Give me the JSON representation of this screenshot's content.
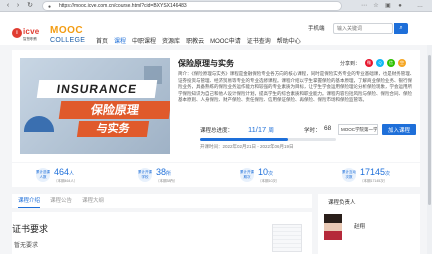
{
  "browser": {
    "url": "https://mooc.icve.com.cn/course.html?cid=BXYSX146483",
    "back_icon": "arrow-left-icon",
    "reload_icon": "reload-icon"
  },
  "header": {
    "logo_icve_text": "icve",
    "logo_icve_sub": "智慧职教",
    "logo_mooc_top": "MOOC",
    "logo_mooc_bottom": "COLLEGE",
    "nav": [
      "首页",
      "课程",
      "中职课程",
      "资源库",
      "职教云",
      "MOOC申请",
      "证书查询",
      "帮助中心"
    ],
    "active_nav": "课程",
    "search_label": "手机端",
    "search_placeholder": "输入关键词",
    "search_icon": "search-icon"
  },
  "course": {
    "title": "保险原理与实务",
    "cover_text_en": "INSURANCE",
    "cover_text_cn1": "保险原理",
    "cover_text_cn2": "与实务",
    "share_label": "分享到：",
    "intro": "简介：《保险原理与实务》课程是金融保险专业各方向的核心课程，同时是保险实务专业的专业基础课，也是财务管理、证券投资与管理、经济贸易等专业的专业选修课程。课程介绍以学生掌握保险的基本原理，了解商业保险业务、银行保险业务，具备熟练的保险业务运作能力和较强的专业素质为目标，让学生学会运用保险理论分析保险现象，学会运用所学保险知识为自己和他人设计保险计划，提高学生的综合素质和职业能力。课程内容包括风险与保险、保险合同、保险基本原则、人身保险、财产保险、责任保险、信用保证保险、再保险、保险市场和保险监管等。",
    "progress_label": "课程总进度：",
    "progress_value": "11/17",
    "progress_unit": "周",
    "progress_fraction": 0.647,
    "credit_label": "学时：",
    "credit_value": "68",
    "dates": "开课时间：2022年02月21日 - 2022年06月19日",
    "mooc_select": "MOOC学院第一学期",
    "join_button": "加入课程"
  },
  "stats": [
    {
      "icon": "students-icon",
      "label": "累计选课人数",
      "value": "464",
      "unit": "人",
      "sub": "（本期464人）"
    },
    {
      "icon": "schools-icon",
      "label": "累计开课学校",
      "value": "38",
      "unit": "所",
      "sub": "（本期38所）"
    },
    {
      "icon": "sessions-icon",
      "label": "累计开课期次",
      "value": "10",
      "unit": "次",
      "sub": "（本期10次）"
    },
    {
      "icon": "interactions-icon",
      "label": "累计互动次数",
      "value": "17145",
      "unit": "次",
      "sub": "（本期17145次）"
    }
  ],
  "tabs": [
    "课程介绍",
    "课程公告",
    "课程大纲"
  ],
  "active_tab": "课程介绍",
  "certificate": {
    "title": "证书要求",
    "none_text": "暂无要求"
  },
  "teacher": {
    "header": "课程负责人",
    "name": "赵翔"
  },
  "colors": {
    "accent": "#1e6fd9",
    "brand_red": "#e03c31",
    "mooc_orange": "#f39c12"
  }
}
